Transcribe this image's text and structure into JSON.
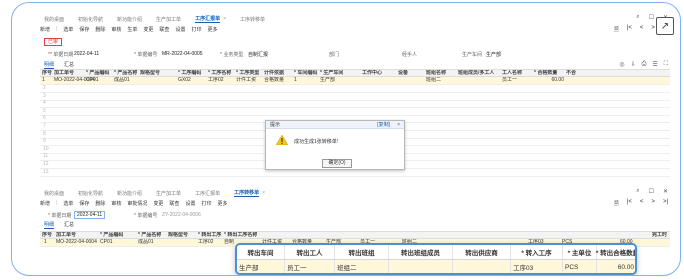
{
  "top": {
    "tabs": [
      "我的桌面",
      "初始化导航",
      "新功能介绍",
      "生产加工单",
      "工序汇报单",
      "工序转移单"
    ],
    "active_tab": "工序汇报单",
    "tab_close": "×",
    "toolbar": [
      "新增",
      "选单",
      "保存",
      "删除",
      "审核",
      "生单",
      "变更",
      "联查",
      "设置",
      "打印",
      "更多"
    ],
    "status": "已审",
    "form": {
      "date_label": "* 单据日期",
      "date_value": "2022-04-11",
      "no_label": "* 单据编号",
      "no_value": "MR-2022-04-0005",
      "type_label": "* 业务类型",
      "type_value": "自制汇报",
      "dept_label": "部门",
      "employee_label": "经手人",
      "workshop_label": "生产车间",
      "workshop_value": "生产部"
    },
    "subtabs": [
      "明细",
      "汇总"
    ],
    "columns": [
      "序号",
      "加工单号",
      "* 产品编码",
      "* 产品名称",
      "规格型号",
      "* 工序编码",
      "* 工序名称",
      "* 工序类型",
      "计件依据",
      "* 车间编码",
      "* 生产车间",
      "工作中心",
      "设备",
      "班组名称",
      "班组成员/多工人",
      "工人名称",
      "* 合格数量",
      "不合"
    ],
    "rows": [
      [
        "1",
        "MO-2022-04-0004",
        "CP01",
        "成品01",
        "",
        "GX02",
        "工序02",
        "计件工资",
        "合格数量",
        "1",
        "生产部",
        "",
        "",
        "班组二",
        "",
        "员工一",
        "60.00",
        ""
      ]
    ],
    "empty_rows": [
      "2",
      "3",
      "4",
      "5",
      "6",
      "7",
      "8",
      "9",
      "10",
      "11",
      "12",
      "13"
    ]
  },
  "dialog": {
    "title": "提示",
    "copy": "[复制]",
    "close": "×",
    "message": "成功生成1张转移单!",
    "ok": "确定(O)"
  },
  "bottom": {
    "tabs": [
      "我的桌面",
      "初始化导航",
      "新功能介绍",
      "生产加工单",
      "工序汇报单",
      "工序转移单"
    ],
    "active_tab": "工序转移单",
    "tab_close": "×",
    "toolbar": [
      "新增",
      "选单",
      "保存",
      "删除",
      "审核",
      "审批情况",
      "变更",
      "联查",
      "设置",
      "打印",
      "更多"
    ],
    "form": {
      "date_label": "* 单据日期",
      "date_value": "2022-04-11",
      "no_label": "* 单据编号",
      "no_value": "ZY-2022-04-0006"
    },
    "subtabs": [
      "明细",
      "汇总"
    ],
    "columns": [
      "序号",
      "加工单号",
      "* 产品编码",
      "* 产品名称",
      "规格型号",
      "* 转出工序",
      "* 转出工序名称"
    ],
    "row": [
      "1",
      "MO-2022-04-0004",
      "CP01",
      "成品01",
      "",
      "工序02",
      "自制",
      "计件工资",
      "合格数量",
      "生产部",
      "员工一",
      "班组二",
      "工序03",
      "PCS",
      "60.00"
    ],
    "right_col": "完工时"
  },
  "popup": {
    "headers": [
      "转出车间",
      "转出工人",
      "转出班组",
      "转出班组成员",
      "转出供应商",
      "* 转入工序",
      "* 主单位",
      "* 转出合格数量"
    ],
    "values": [
      "生产部",
      "员工一",
      "班组二",
      "",
      "",
      "工序03",
      "PCS",
      "60.00"
    ]
  },
  "icons": {
    "external": "external-link-icon",
    "search": "search-icon",
    "close": "close-icon"
  }
}
